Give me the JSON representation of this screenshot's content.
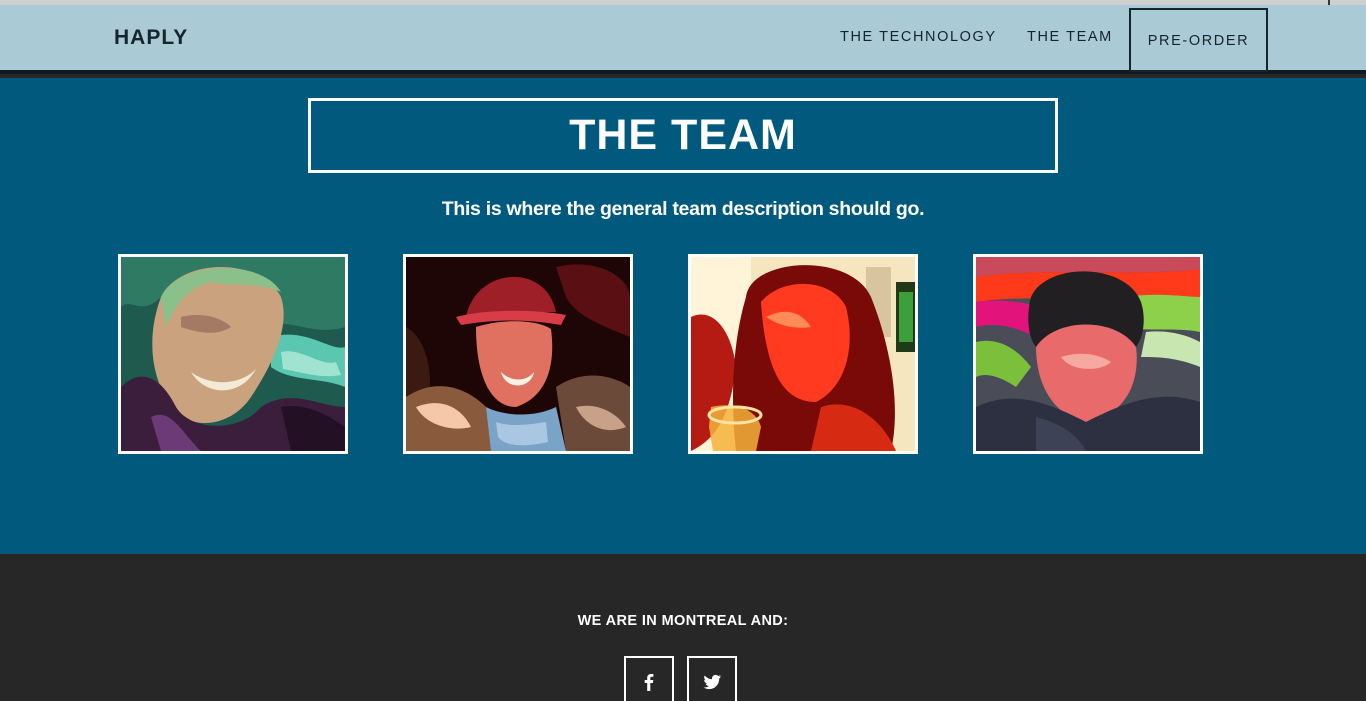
{
  "nav": {
    "brand": "HAPLY",
    "links": [
      "THE TECHNOLOGY",
      "THE TEAM"
    ],
    "cta": "PRE-ORDER"
  },
  "team": {
    "title": "THE TEAM",
    "description": "This is where the general team description should go.",
    "members": [
      {
        "photo": "team-member-photo-1"
      },
      {
        "photo": "team-member-photo-2"
      },
      {
        "photo": "team-member-photo-3"
      },
      {
        "photo": "team-member-photo-4"
      }
    ]
  },
  "footer": {
    "text": "WE ARE IN MONTREAL AND:",
    "social": [
      {
        "icon": "facebook-icon"
      },
      {
        "icon": "twitter-icon"
      }
    ]
  },
  "colors": {
    "navbar_bg": "#aacad6",
    "section_bg": "#015a7e",
    "footer_bg": "#272727",
    "text_dark": "#16242b",
    "text_light": "#ffffff"
  }
}
